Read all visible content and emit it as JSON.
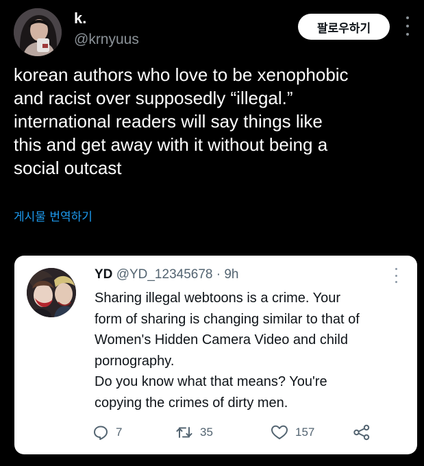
{
  "author": {
    "display_name": "k.",
    "handle": "@krnyuus",
    "avatar_icon": "profile-photo-avatar"
  },
  "header": {
    "follow_label": "팔로우하기",
    "more_icon": "more-vertical-icon"
  },
  "tweet": {
    "text": "korean authors who love to be xenophobic\nand racist over supposedly “illegal.”\ninternational readers will say things like\nthis and get away with it without being a\nsocial outcast",
    "translate_label": "게시물 번역하기"
  },
  "quoted_tweet": {
    "display_name": "YD",
    "handle_time": "@YD_12345678 · 9h",
    "text": "Sharing illegal webtoons is a crime. Your\nform of sharing is changing similar to that of\nWomen's Hidden Camera Video and child\npornography.\nDo you know what that means? You're\ncopying the crimes of dirty men.",
    "avatar_icon": "illustrated-character-avatar",
    "actions": {
      "replies": "7",
      "retweets": "35",
      "likes": "157"
    }
  },
  "colors": {
    "background": "#000000",
    "link": "#1d9bf0",
    "card": "#ffffff",
    "muted": "#536471"
  }
}
